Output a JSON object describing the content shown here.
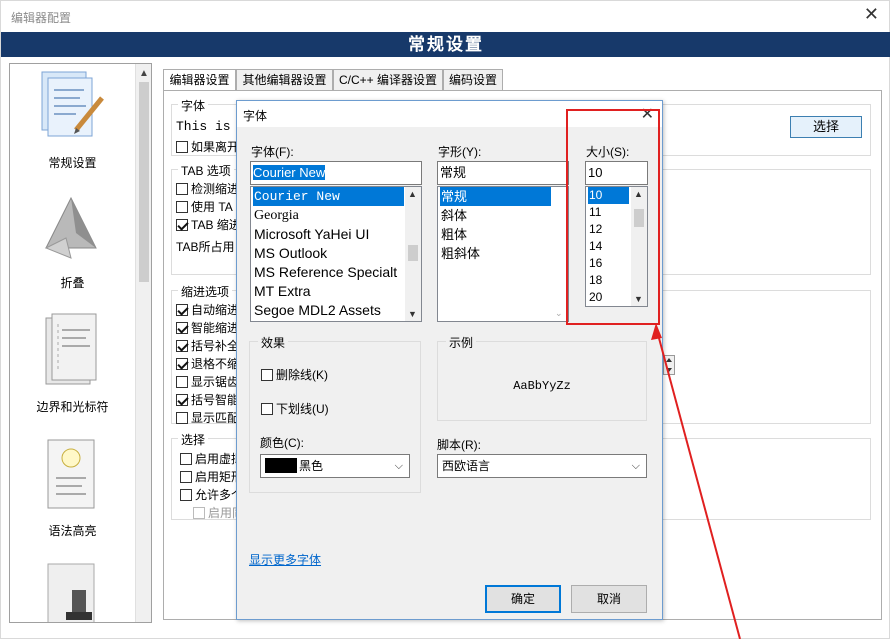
{
  "window": {
    "title": "编辑器配置",
    "banner": "常规设置",
    "close_glyph": "✕"
  },
  "sidebar": {
    "items": [
      {
        "label": "常规设置",
        "icon": "general-settings-icon"
      },
      {
        "label": "折叠",
        "icon": "fold-icon"
      },
      {
        "label": "边界和光标符",
        "icon": "margin-cursor-icon"
      },
      {
        "label": "语法高亮",
        "icon": "syntax-highlight-icon"
      },
      {
        "label": "",
        "icon": "stamp-icon"
      }
    ]
  },
  "tabs": [
    {
      "label": "编辑器设置",
      "active": true
    },
    {
      "label": "其他编辑器设置",
      "active": false
    },
    {
      "label": "C/C++ 编译器设置",
      "active": false
    },
    {
      "label": "编码设置",
      "active": false
    }
  ],
  "background": {
    "font_group": "字体",
    "font_preview": "This is",
    "if_leave": "如果离开",
    "select_button": "选择",
    "tab_group": "TAB 选项",
    "tab_items": [
      "检测缩进",
      "使用 TA",
      "TAB 缩进"
    ],
    "tab_checked": [
      false,
      false,
      true
    ],
    "tab_occupy": "TAB所占用",
    "indent_group": "缩进选项",
    "indent_items": [
      "自动缩进",
      "智能缩进",
      "括号补全",
      "退格不缩",
      "显示锯齿",
      "括号智能",
      "显示匹配"
    ],
    "indent_checked": [
      true,
      true,
      true,
      true,
      false,
      true,
      false
    ],
    "select_group": "选择",
    "select_items": [
      "启用虚拟",
      "启用矩形",
      "允许多个",
      "启用同"
    ],
    "select_checked": [
      false,
      false,
      false,
      false
    ]
  },
  "dialog": {
    "title": "字体",
    "font_label": "字体(F):",
    "font_value": "Courier New",
    "font_list": [
      "Courier New",
      "Georgia",
      "Microsoft YaHei UI",
      "MS Outlook",
      "MS Reference Specialt",
      "MT Extra",
      "Segoe MDL2 Assets"
    ],
    "font_selected_index": 0,
    "style_label": "字形(Y):",
    "style_value": "常规",
    "style_list": [
      "常规",
      "斜体",
      "粗体",
      "粗斜体"
    ],
    "style_selected_index": 0,
    "size_label": "大小(S):",
    "size_value": "10",
    "size_list": [
      "10",
      "11",
      "12",
      "14",
      "16",
      "18",
      "20"
    ],
    "size_selected_index": 0,
    "effects_group": "效果",
    "strikeout": "删除线(K)",
    "underline": "下划线(U)",
    "color_label": "颜色(C):",
    "color_value": "黑色",
    "color_hex": "#000000",
    "sample_group": "示例",
    "sample_text": "AaBbYyZz",
    "script_label": "脚本(R):",
    "script_value": "西欧语言",
    "more_fonts_link": "显示更多字体",
    "ok_button": "确定",
    "cancel_button": "取消"
  },
  "annotation": {
    "highlight_color": "#e02020"
  }
}
